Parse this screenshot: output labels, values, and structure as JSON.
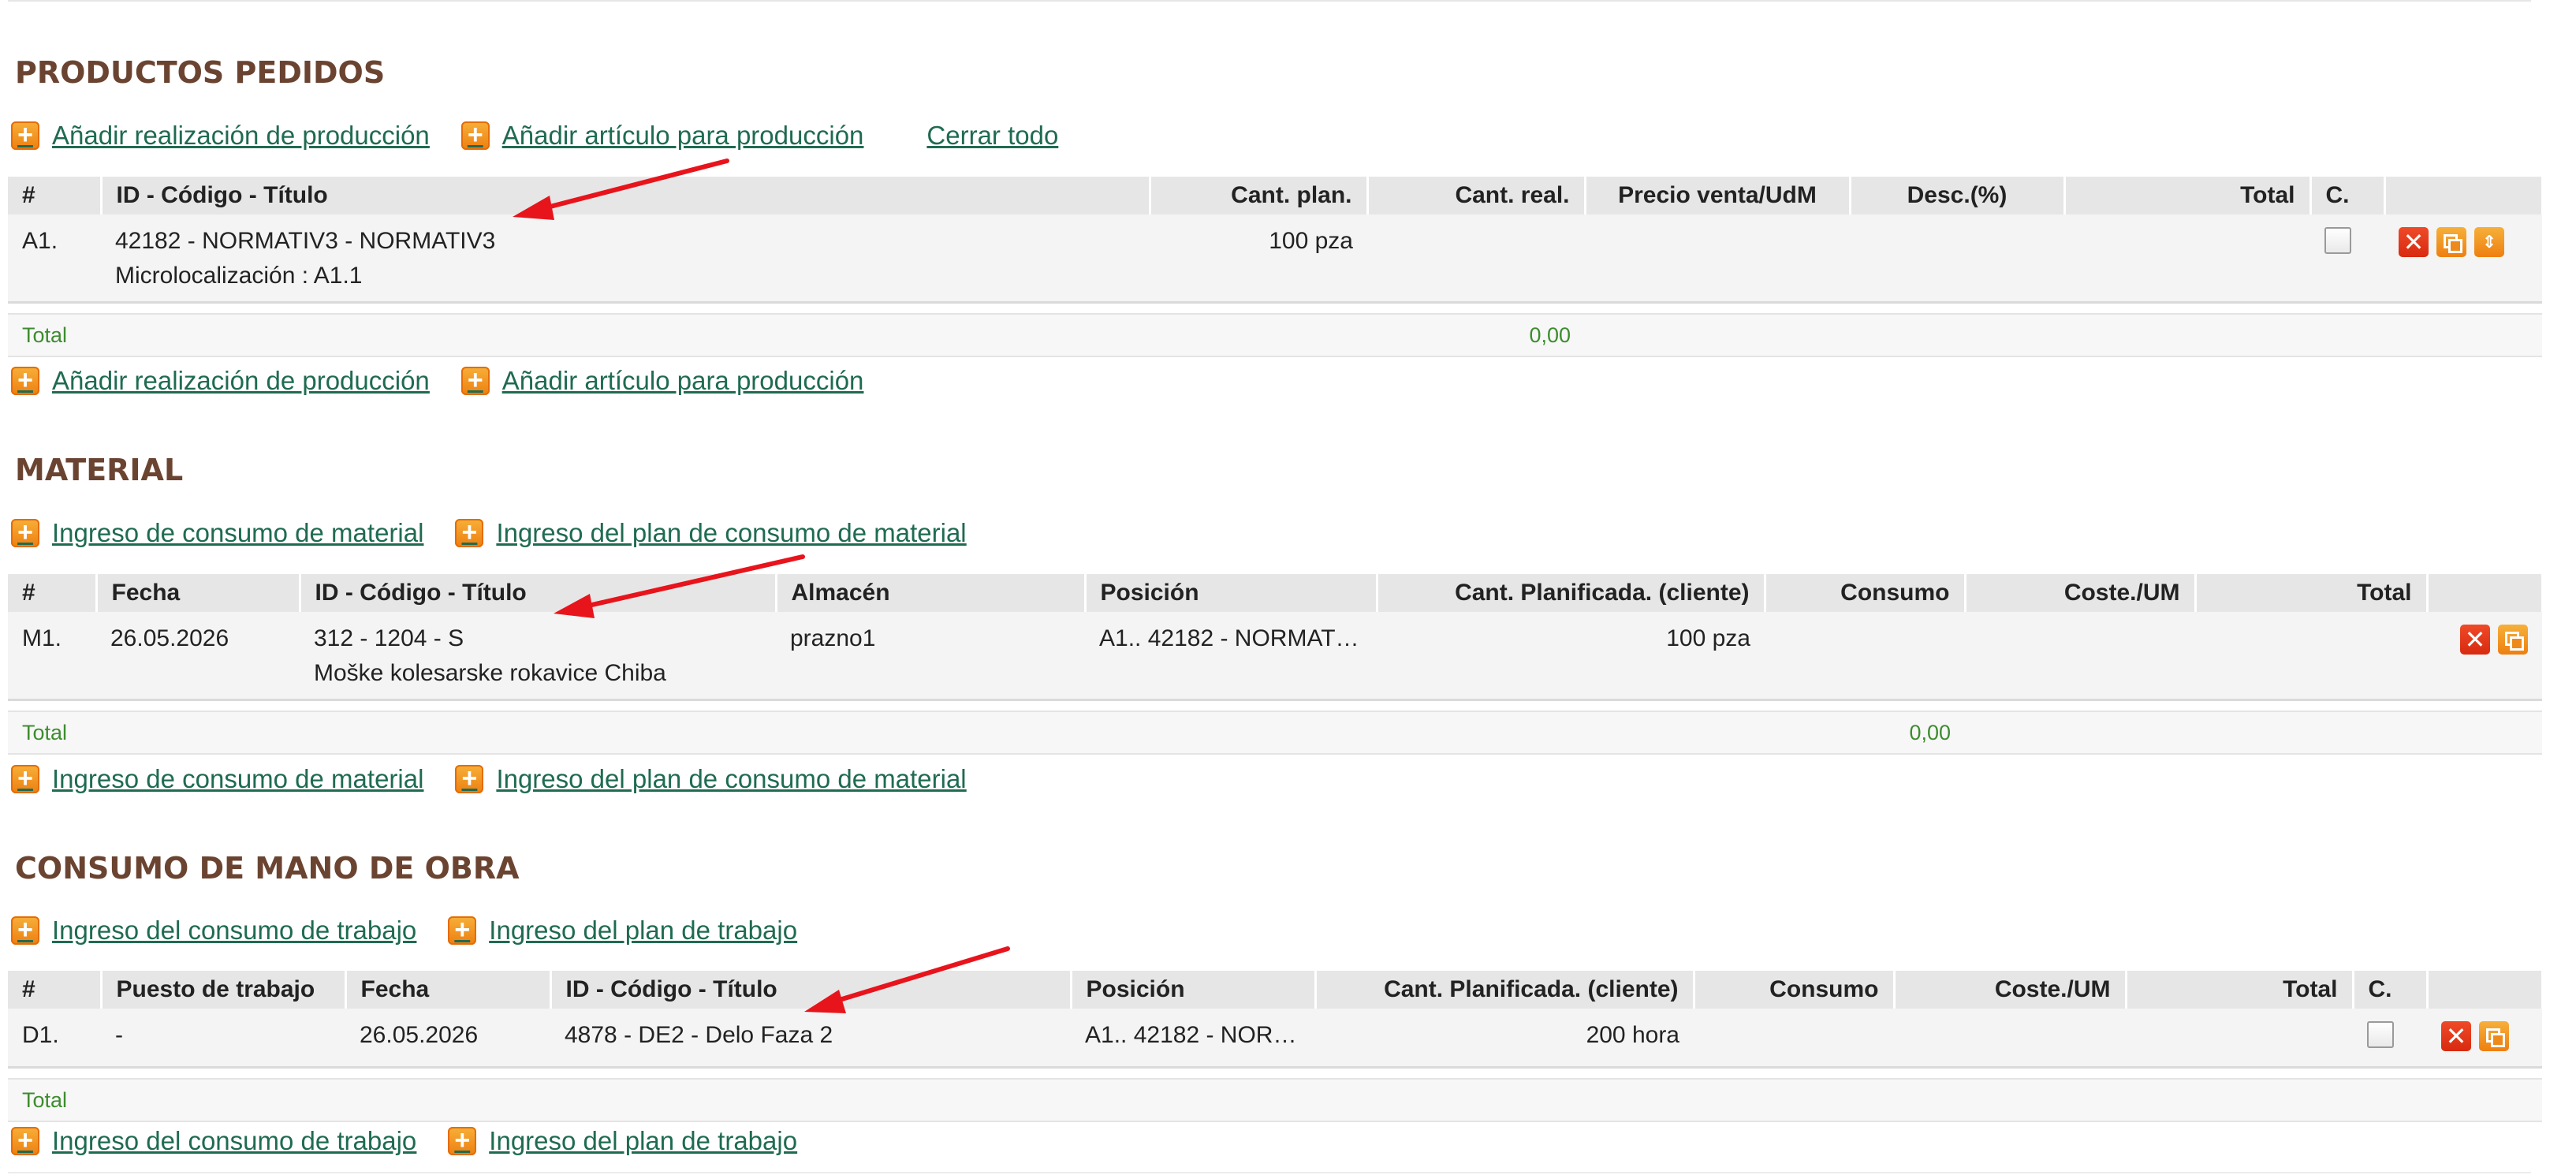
{
  "productos": {
    "title": "PRODUCTOS PEDIDOS",
    "actions": [
      "Añadir realización de producción",
      "Añadir artículo para producción"
    ],
    "close_all": "Cerrar todo",
    "columns": [
      "#",
      "ID - Código - Título",
      "Cant. plan.",
      "Cant. real.",
      "Precio venta/UdM",
      "Desc.(%)",
      "Total",
      "C."
    ],
    "row": {
      "num": "A1.",
      "title": "42182 - NORMATIV3 - NORMATIV3",
      "sub": "Microlocalización : A1.1",
      "cant_plan": "100 pza"
    },
    "total_label": "Total",
    "total_value": "0,00"
  },
  "material": {
    "title": "MATERIAL",
    "actions": [
      "Ingreso de consumo de material",
      "Ingreso del plan de consumo de material"
    ],
    "columns": [
      "#",
      "Fecha",
      "ID - Código - Título",
      "Almacén",
      "Posición",
      "Cant. Planificada. (cliente)",
      "Consumo",
      "Coste./UM",
      "Total"
    ],
    "row": {
      "num": "M1.",
      "fecha": "26.05.2026",
      "title": "312 - 1204 - S",
      "sub": "Moške kolesarske rokavice Chiba",
      "almacen": "prazno1",
      "posicion": "A1.. 42182 - NORMAT…",
      "cant": "100 pza"
    },
    "total_label": "Total",
    "total_value": "0,00"
  },
  "mano": {
    "title": "CONSUMO DE MANO DE OBRA",
    "actions": [
      "Ingreso del consumo de trabajo",
      "Ingreso del plan de trabajo"
    ],
    "columns": [
      "#",
      "Puesto de trabajo",
      "Fecha",
      "ID - Código - Título",
      "Posición",
      "Cant. Planificada. (cliente)",
      "Consumo",
      "Coste./UM",
      "Total",
      "C."
    ],
    "row": {
      "num": "D1.",
      "puesto": "-",
      "fecha": "26.05.2026",
      "title": "4878 - DE2 - Delo Faza 2",
      "posicion": "A1.. 42182 - NOR…",
      "cant": "200 hora"
    },
    "total_label": "Total"
  },
  "icons": {
    "plus": "+",
    "delete": "✕",
    "move": "⇕"
  },
  "colors": {
    "title": "#6b4431",
    "link": "#1f6b52",
    "total": "#3d8c2e",
    "arrow": "#e8141c",
    "accent": "#ee7f10"
  }
}
